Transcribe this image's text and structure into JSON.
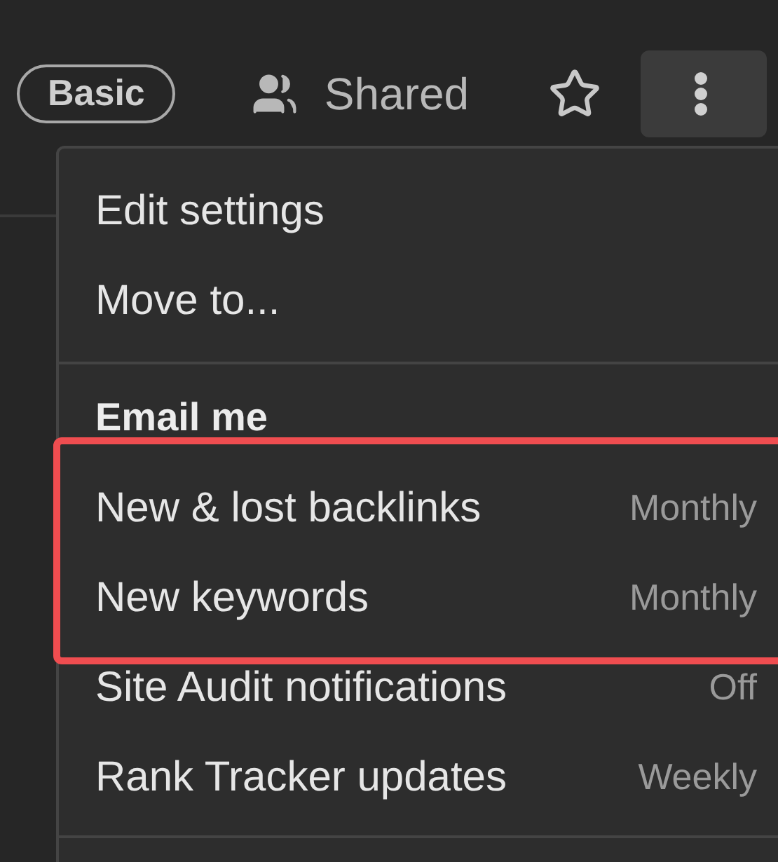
{
  "toolbar": {
    "badge": "Basic",
    "shared": "Shared",
    "starred": false
  },
  "menu": {
    "items": [
      {
        "label": "Edit settings"
      },
      {
        "label": "Move to..."
      }
    ],
    "section_title": "Email me",
    "email_items": [
      {
        "label": "New & lost backlinks",
        "value": "Monthly",
        "highlighted": true
      },
      {
        "label": "New keywords",
        "value": "Monthly",
        "highlighted": true
      },
      {
        "label": "Site Audit notifications",
        "value": "Off",
        "highlighted": false
      },
      {
        "label": "Rank Tracker updates",
        "value": "Weekly",
        "highlighted": false
      }
    ]
  }
}
